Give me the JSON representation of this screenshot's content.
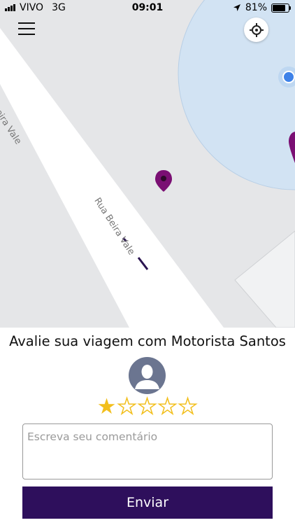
{
  "status_bar": {
    "carrier": "VIVO",
    "network": "3G",
    "time": "09:01",
    "battery": "81%",
    "battery_level": 0.81,
    "icons": [
      "signal-bars",
      "location-arrow",
      "battery"
    ]
  },
  "map": {
    "street_names": [
      "Rua Beira Vale",
      "Rua Beira Vale"
    ],
    "colors": {
      "map_bg": "#e5e6e8",
      "road": "#ffffff",
      "radius": "#d2e3f3",
      "pin": "#7a0f73",
      "user_dot": "#3e82e8"
    },
    "icons": [
      "menu-icon",
      "crosshair-icon",
      "map-pin-icon",
      "user-location-icon"
    ]
  },
  "rating": {
    "title": "Avalie sua viagem com Motorista Santos",
    "stars_total": 5,
    "stars_selected": 1,
    "comment_placeholder": "Escreva seu comentário",
    "comment_value": "",
    "submit_label": "Enviar",
    "colors": {
      "star": "#f2bf1d",
      "button": "#2e0f5c",
      "avatar": "#6b7590"
    }
  }
}
